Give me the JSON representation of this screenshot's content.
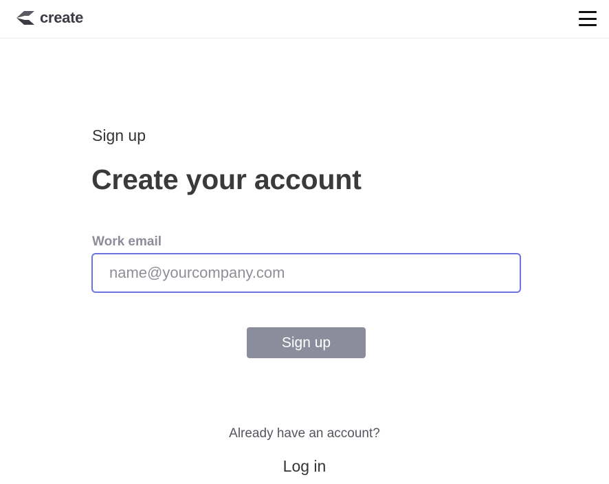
{
  "header": {
    "logo_text": "create",
    "logo_icon": "create-logo-icon",
    "menu_icon": "hamburger-menu-icon"
  },
  "form": {
    "eyebrow": "Sign up",
    "title": "Create your account",
    "email_label": "Work email",
    "email_placeholder": "name@yourcompany.com",
    "email_value": "",
    "submit_label": "Sign up"
  },
  "footer": {
    "prompt": "Already have an account?",
    "login_label": "Log in"
  },
  "colors": {
    "input_focus_border": "#6b73e0",
    "button_bg": "#8b8d9c",
    "label": "#8c8c9a",
    "text": "#3a3a3c"
  }
}
